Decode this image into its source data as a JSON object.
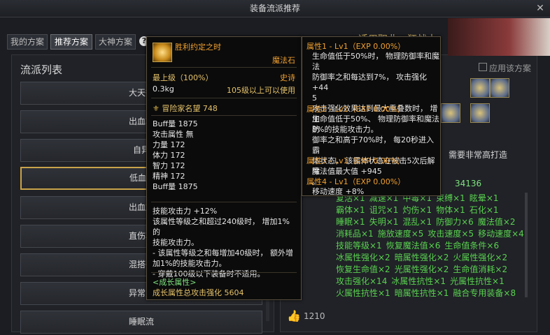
{
  "window": {
    "title": "装备流派推荐",
    "close_label": "✕"
  },
  "tabs": [
    {
      "label": "我的方案"
    },
    {
      "label": "推荐方案"
    },
    {
      "label": "大神方案"
    }
  ],
  "left": {
    "title": "流派列表",
    "items": [
      "大天御",
      "出血攻",
      "自异",
      "低血攻",
      "出血加",
      "直伤攻",
      "混搭强",
      "异常对",
      "睡眠流"
    ]
  },
  "right": {
    "job_title": "适用职业：狂战士",
    "apply_label": "应用该方案",
    "need_text": "需要非常高打造",
    "num_val": "34136",
    "attr_rows": [
      [
        "复活×1",
        "减速×1",
        "中毒×1",
        "束缚×1",
        "眩晕×1"
      ],
      [
        "霸体×1",
        "诅咒×1",
        "灼伤×1",
        "物体×1",
        "石化×1"
      ],
      [
        "睡眠×1",
        "失明×1",
        "混乱×1",
        "防御力×6",
        "魔法值×2"
      ],
      [
        "消耗品×1",
        "施放速度×5",
        "攻击速度×5",
        "移动速度×4"
      ],
      [
        "技能等级×1",
        "恢复魔法值×6",
        "生命值条件×6"
      ],
      [
        "冰属性强化×2",
        "暗属性强化×2",
        "火属性强化×2"
      ],
      [
        "恢复生命值×2",
        "光属性强化×2",
        "生命值消耗×2"
      ],
      [
        "攻击强化×14",
        "冰属性抗性×1",
        "光属性抗性×1"
      ],
      [
        "火属性抗性×1",
        "暗属性抗性×1",
        "融合专用装备×8"
      ]
    ],
    "likes": "1210"
  },
  "tooltip_item": {
    "name": "胜利约定之时",
    "type": "魔法石",
    "grade": "最上级（100%）",
    "rarity": "史诗",
    "weight": "0.3kg",
    "level_req": "105级以上可以使用",
    "fame": "冒险家名望 748",
    "stats": [
      "Buff量 1875",
      "攻击属性 無",
      "力量 172",
      "体力 172",
      "智力 172",
      "精神 172",
      "Buff量 1875"
    ],
    "desc": [
      "技能攻击力 +12%",
      "该属性等级之和超过240级时， 增加1%的",
      "技能攻击力。",
      "- 该属性等级之和每增加40级时， 额外增",
      "加1%的技能攻击力。",
      "- 穿戴100级以下装备时不适用。"
    ],
    "growth_title": "<成长属性>",
    "growth_value": "成长属性总攻击强化 5604"
  },
  "tooltip_attrs": [
    {
      "header": "属性1 - Lv1（EXP 0.00%）",
      "lines": [
        "生命值低于50%时， 物理防御率和魔法",
        "防御率之和每达到7%， 攻击强化 +44",
        "5",
        "攻击强化效果达到最大重叠数时， 增加",
        "8%的技能攻击力。"
      ]
    },
    {
      "header": "属性2 - Lv1（EXP 0.00%）",
      "lines": [
        "生命值低于50%、 物理防御率和魔法防",
        "御率之和高于70%时， 每20秒进入霸",
        "体状态， 该霸体状态在被击5次后解除",
        "。"
      ]
    },
    {
      "header": "属性3 - Lv1（EXP 0.00%）",
      "lines": [
        "魔法值最大值 +945"
      ]
    },
    {
      "header": "属性4 - Lv1（EXP 0.00%）",
      "lines": [
        "移动速度 +8%"
      ]
    }
  ]
}
